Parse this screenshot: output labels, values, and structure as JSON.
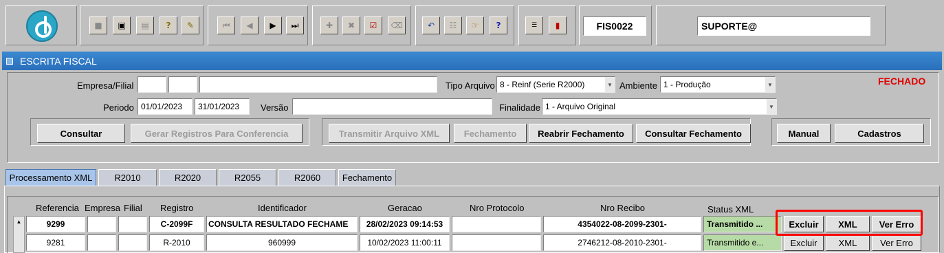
{
  "toolbar": {
    "code": "FIS0022",
    "user": "SUPORTE@",
    "icons": [
      "save-icon",
      "print-preview-icon",
      "print-icon",
      "query-help-icon",
      "edit-icon",
      "first-record-icon",
      "prev-record-icon",
      "next-record-icon",
      "last-record-icon",
      "insert-record-icon",
      "delete-record-icon",
      "execute-query-icon",
      "clear-icon",
      "undo-icon",
      "copy-icon",
      "keys-icon",
      "help-icon",
      "menu-icon",
      "exit-icon"
    ]
  },
  "window": {
    "title": "ESCRITA FISCAL"
  },
  "form": {
    "empresa_label": "Empresa/Filial",
    "empresa_value": "",
    "filial_value": "",
    "empresa_nome": "",
    "tipo_arquivo_label": "Tipo Arquivo",
    "tipo_arquivo_value": "8 - Reinf (Serie R2000)",
    "ambiente_label": "Ambiente",
    "ambiente_value": "1 - Produção",
    "status": "FECHADO",
    "periodo_label": "Periodo",
    "periodo_inicio": "01/01/2023",
    "periodo_fim": "31/01/2023",
    "versao_label": "Versão",
    "versao_value": "",
    "finalidade_label": "Finalidade",
    "finalidade_value": "1 - Arquivo Original"
  },
  "buttons": {
    "consultar": "Consultar",
    "gerar": "Gerar Registros Para Conferencia",
    "transmitir": "Transmitir Arquivo XML",
    "fechamento": "Fechamento",
    "reabrir": "Reabrir Fechamento",
    "consultar_fechamento": "Consultar Fechamento",
    "manual": "Manual",
    "cadastros": "Cadastros"
  },
  "tabs": [
    "Processamento XML",
    "R2010",
    "R2020",
    "R2055",
    "R2060",
    "Fechamento"
  ],
  "table": {
    "headers": [
      "Referencia",
      "Empresa",
      "Filial",
      "Registro",
      "Identificador",
      "Geracao",
      "Nro Protocolo",
      "Nro Recibo",
      "Status XML"
    ],
    "rows": [
      {
        "referencia": "9299",
        "empresa": "",
        "filial": "",
        "registro": "C-2099F",
        "identificador": "CONSULTA RESULTADO FECHAME",
        "geracao": "28/02/2023 09:14:53",
        "protocolo": "",
        "recibo": "4354022-08-2099-2301-",
        "status": "Transmitido ...",
        "excluir": "Excluir",
        "xml": "XML",
        "ver_erro": "Ver Erro"
      },
      {
        "referencia": "9281",
        "empresa": "",
        "filial": "",
        "registro": "R-2010",
        "identificador": "960999",
        "geracao": "10/02/2023 11:00:11",
        "protocolo": "",
        "recibo": "2746212-08-2010-2301-",
        "status": "Transmitido e...",
        "excluir": "Excluir",
        "xml": "XML",
        "ver_erro": "Ver Erro"
      }
    ]
  }
}
